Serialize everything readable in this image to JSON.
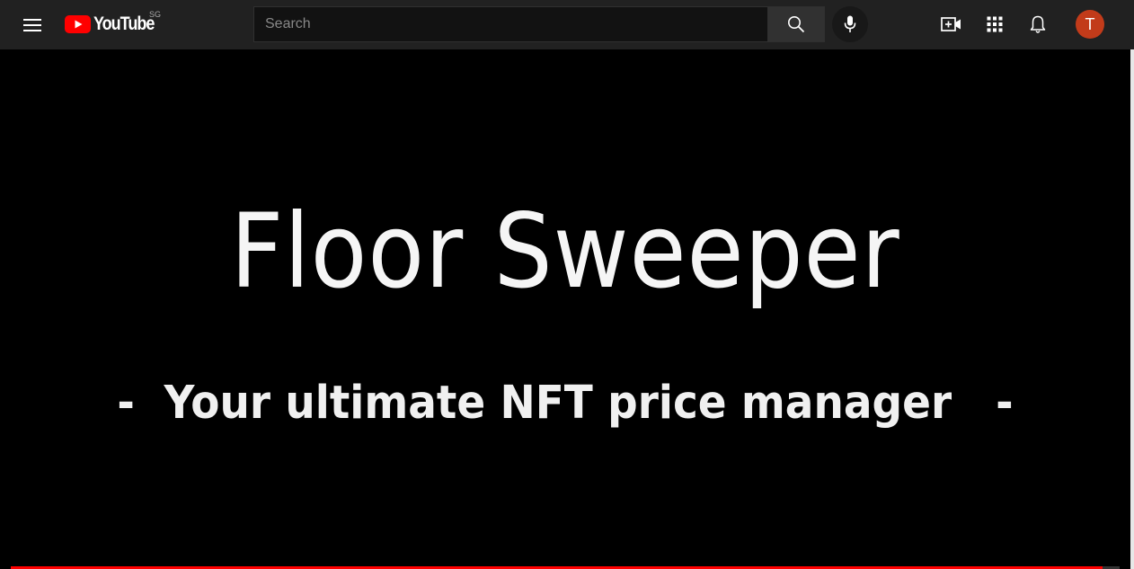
{
  "header": {
    "logo_text": "YouTube",
    "country_code": "SG",
    "search": {
      "placeholder": "Search",
      "value": ""
    },
    "icons": {
      "menu": "hamburger-menu-icon",
      "search": "search-icon",
      "mic": "microphone-icon",
      "create": "create-video-icon",
      "apps": "apps-grid-icon",
      "notifications": "bell-icon"
    },
    "avatar_letter": "T"
  },
  "video": {
    "title": "Floor Sweeper",
    "subtitle": "-  Your ultimate NFT price manager   -",
    "progress_fraction": 0.985
  },
  "colors": {
    "brand_red": "#ff0000",
    "avatar_bg": "#c23b1a",
    "topbar_bg": "#212121",
    "player_bg": "#000000"
  }
}
